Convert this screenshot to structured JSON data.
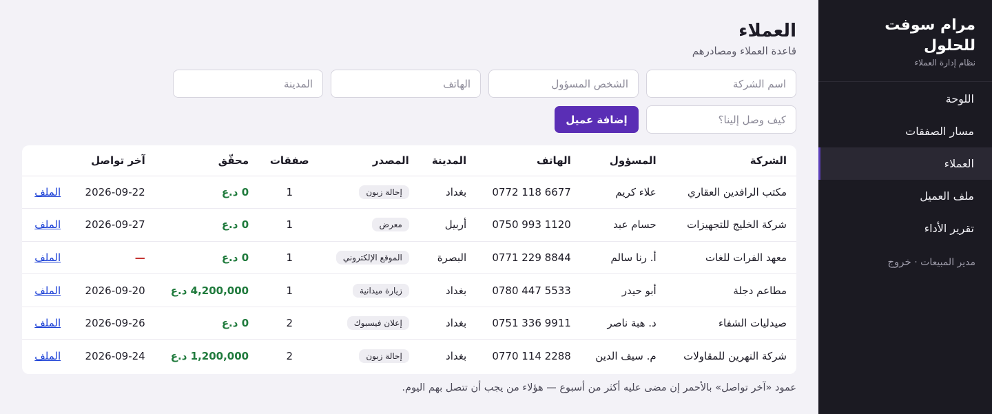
{
  "app": {
    "title": "مرام سوفت للحلول",
    "subtitle": "نظام إدارة العملاء"
  },
  "nav": {
    "items": [
      {
        "label": "اللوحة"
      },
      {
        "label": "مسار الصفقات"
      },
      {
        "label": "العملاء"
      },
      {
        "label": "ملف العميل"
      },
      {
        "label": "تقرير الأداء"
      }
    ],
    "user": "مدير المبيعات ·",
    "logout": "خروج"
  },
  "page": {
    "title": "العملاء",
    "subtitle": "قاعدة العملاء ومصادرهم"
  },
  "form": {
    "company_placeholder": "اسم الشركة",
    "contact_placeholder": "الشخص المسؤول",
    "phone_placeholder": "الهاتف",
    "city_placeholder": "المدينة",
    "source_placeholder": "كيف وصل إلينا؟",
    "add_button": "إضافة عميل"
  },
  "table": {
    "headers": [
      "الشركة",
      "المسؤول",
      "الهاتف",
      "المدينة",
      "المصدر",
      "صفقات",
      "محقّق",
      "آخر تواصل",
      ""
    ],
    "rows": [
      {
        "company": "مكتب الرافدين العقاري",
        "contact": "علاء كريم",
        "phone": "0772 118 6677",
        "city": "بغداد",
        "source": "إحالة زبون",
        "deals": "1",
        "achieved": "0 د.ع",
        "last": "2026-09-22",
        "link": "الملف"
      },
      {
        "company": "شركة الخليج للتجهيزات",
        "contact": "حسام عبد",
        "phone": "0750 993 1120",
        "city": "أربيل",
        "source": "معرض",
        "deals": "1",
        "achieved": "0 د.ع",
        "last": "2026-09-27",
        "link": "الملف"
      },
      {
        "company": "معهد الفرات للغات",
        "contact": "أ. رنا سالم",
        "phone": "0771 229 8844",
        "city": "البصرة",
        "source": "الموقع الإلكتروني",
        "deals": "1",
        "achieved": "0 د.ع",
        "last": "—",
        "link": "الملف"
      },
      {
        "company": "مطاعم دجلة",
        "contact": "أبو حيدر",
        "phone": "0780 447 5533",
        "city": "بغداد",
        "source": "زيارة ميدانية",
        "deals": "1",
        "achieved": "4,200,000 د.ع",
        "last": "2026-09-20",
        "link": "الملف"
      },
      {
        "company": "صيدليات الشفاء",
        "contact": "د. هبة ناصر",
        "phone": "0751 336 9911",
        "city": "بغداد",
        "source": "إعلان فيسبوك",
        "deals": "2",
        "achieved": "0 د.ع",
        "last": "2026-09-26",
        "link": "الملف"
      },
      {
        "company": "شركة النهرين للمقاولات",
        "contact": "م. سيف الدين",
        "phone": "0770 114 2288",
        "city": "بغداد",
        "source": "إحالة زبون",
        "deals": "2",
        "achieved": "1,200,000 د.ع",
        "last": "2026-09-24",
        "link": "الملف"
      }
    ]
  },
  "footnote": "عمود «آخر تواصل» بالأحمر إن مضى عليه أكثر من أسبوع — هؤلاء من يجب أن تتصل بهم اليوم.",
  "colors": {
    "accent": "#5a2eb5",
    "sidebar": "#1b1a22",
    "money": "#1f7a3c",
    "stale": "#c4312f",
    "link": "#1a3fd6"
  }
}
